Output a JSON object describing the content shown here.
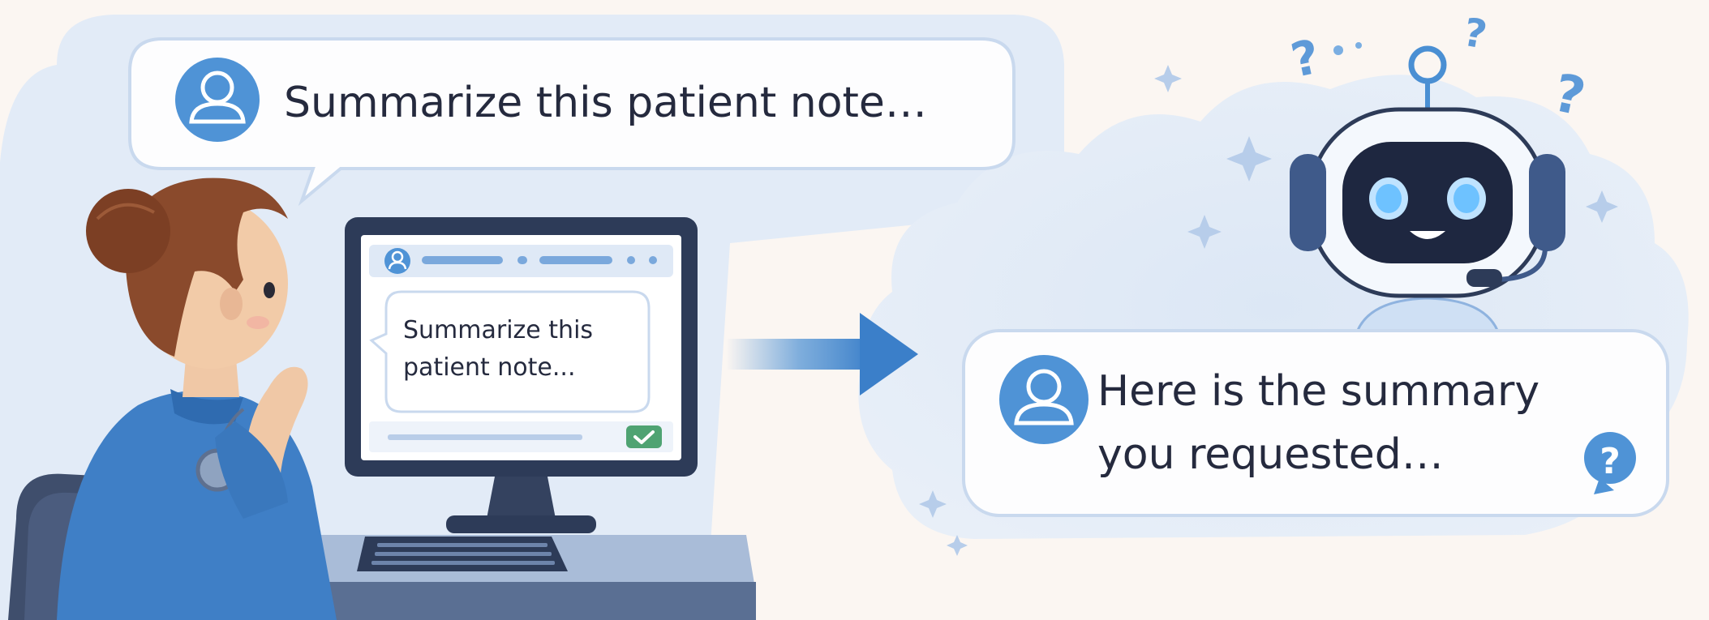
{
  "prompt_bubble": {
    "text": "Summarize this patient note…"
  },
  "monitor": {
    "chat_text_line1": "Summarize this",
    "chat_text_line2": "patient note..."
  },
  "response_bubble": {
    "line1": "Here is the summary",
    "line2": "you requested…"
  },
  "question_marks": [
    "?",
    "?",
    "?",
    "?"
  ],
  "help_badge": "?",
  "colors": {
    "background": "#fbf6f2",
    "panel_blue": "#e2ebf7",
    "accent_blue": "#4a8fd3",
    "navy": "#27324a",
    "text_dark": "#22263a",
    "check_green": "#4fa372"
  },
  "icons": [
    "user-avatar-icon",
    "robot-icon",
    "arrow-right-icon",
    "checkmark-icon",
    "question-icon",
    "sparkle-icon"
  ]
}
